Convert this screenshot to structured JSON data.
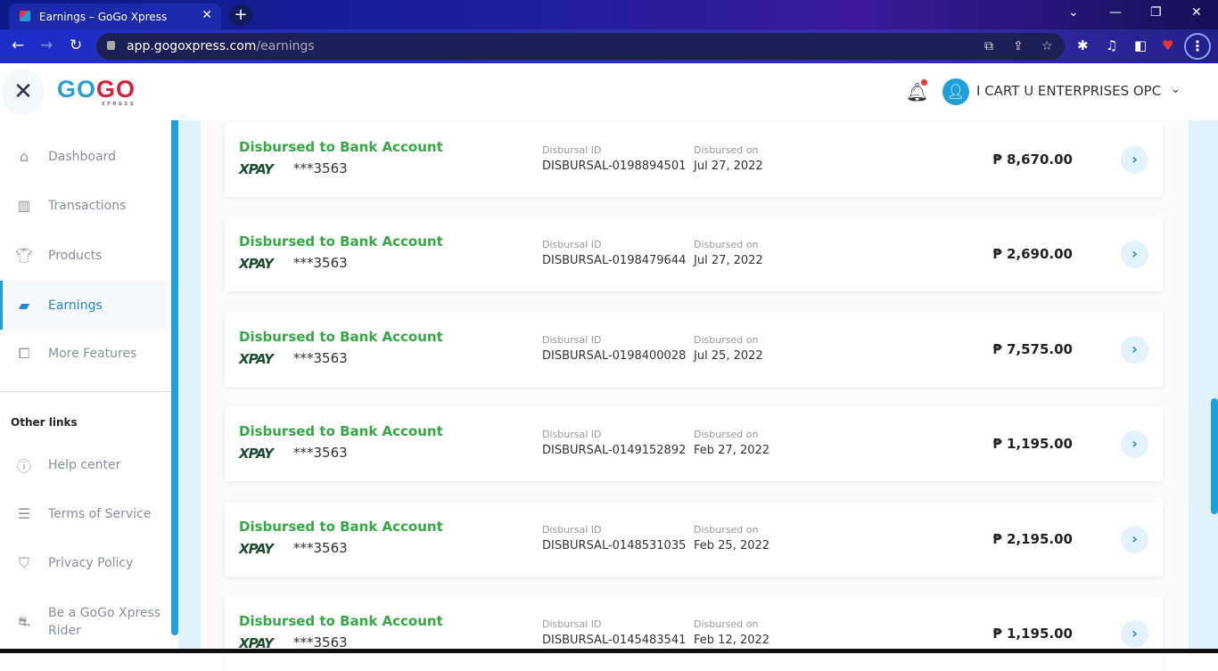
{
  "browser": {
    "tab_title": "Earnings – GoGo Xpress",
    "url_host": "app.gogoxpress.com",
    "url_path": "/earnings"
  },
  "header": {
    "logo_main_1": "GO",
    "logo_main_2": "GO",
    "logo_sub": "XPRESS",
    "user_name": "I CART U ENTERPRISES OPC"
  },
  "sidebar": {
    "items": [
      {
        "label": "Dashboard",
        "icon": "home-icon"
      },
      {
        "label": "Transactions",
        "icon": "chart-icon"
      },
      {
        "label": "Products",
        "icon": "shirt-icon"
      },
      {
        "label": "Earnings",
        "icon": "wallet-icon",
        "active": true
      },
      {
        "label": "More Features",
        "icon": "puzzle-icon"
      }
    ],
    "other_links_title": "Other links",
    "other_links": [
      {
        "label": "Help center"
      },
      {
        "label": "Terms of Service"
      },
      {
        "label": "Privacy Policy"
      },
      {
        "label": "Be a GoGo Xpress Rider"
      }
    ]
  },
  "labels": {
    "disbursal_id": "Disbursal ID",
    "disbursed_on": "Disbursed on"
  },
  "disbursals": [
    {
      "title": "Disbursed to Bank Account",
      "provider": "XPAY",
      "account": "***3563",
      "id": "DISBURSAL-0198894501",
      "date": "Jul 27, 2022",
      "amount": "₱ 8,670.00"
    },
    {
      "title": "Disbursed to Bank Account",
      "provider": "XPAY",
      "account": "***3563",
      "id": "DISBURSAL-0198479644",
      "date": "Jul 27, 2022",
      "amount": "₱ 2,690.00"
    },
    {
      "title": "Disbursed to Bank Account",
      "provider": "XPAY",
      "account": "***3563",
      "id": "DISBURSAL-0198400028",
      "date": "Jul 25, 2022",
      "amount": "₱ 7,575.00"
    },
    {
      "title": "Disbursed to Bank Account",
      "provider": "XPAY",
      "account": "***3563",
      "id": "DISBURSAL-0149152892",
      "date": "Feb 27, 2022",
      "amount": "₱ 1,195.00"
    },
    {
      "title": "Disbursed to Bank Account",
      "provider": "XPAY",
      "account": "***3563",
      "id": "DISBURSAL-0148531035",
      "date": "Feb 25, 2022",
      "amount": "₱ 2,195.00"
    },
    {
      "title": "Disbursed to Bank Account",
      "provider": "XPAY",
      "account": "***3563",
      "id": "DISBURSAL-0145483541",
      "date": "Feb 12, 2022",
      "amount": "₱ 1,195.00"
    }
  ]
}
